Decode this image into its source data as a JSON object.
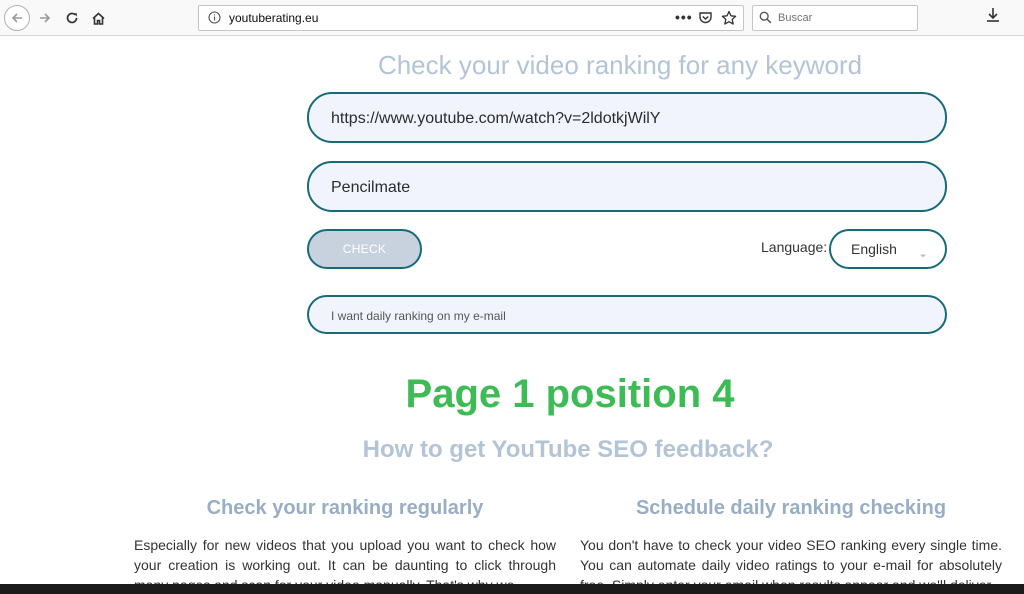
{
  "browser": {
    "url": "youtuberating.eu",
    "search_placeholder": "Buscar"
  },
  "page": {
    "heading": "Check your video ranking for any keyword",
    "video_url_value": "https://www.youtube.com/watch?v=2ldotkjWilY",
    "keyword_value": "Pencilmate",
    "check_button": "CHECK",
    "language_label": "Language:",
    "language_value": "English",
    "email_placeholder": "I want daily ranking on my e-mail",
    "result": "Page 1 position 4",
    "seo_heading": "How to get YouTube SEO feedback?",
    "col1": {
      "title": "Check your ranking regularly",
      "body": "Especially for new videos that you upload you want to check how your creation is working out. It can be daunting to click through many pages and scan for your video manually. That's why we"
    },
    "col2": {
      "title": "Schedule daily ranking checking",
      "body": "You don't have to check your video SEO ranking every single time. You can automate daily video ratings to your e-mail for absolutely free. Simply enter your email when results appear and we'll deliver"
    }
  },
  "colors": {
    "accent_border": "#176b78",
    "result_green": "#3dbb55",
    "heading_blue": "#b3c4d6"
  }
}
